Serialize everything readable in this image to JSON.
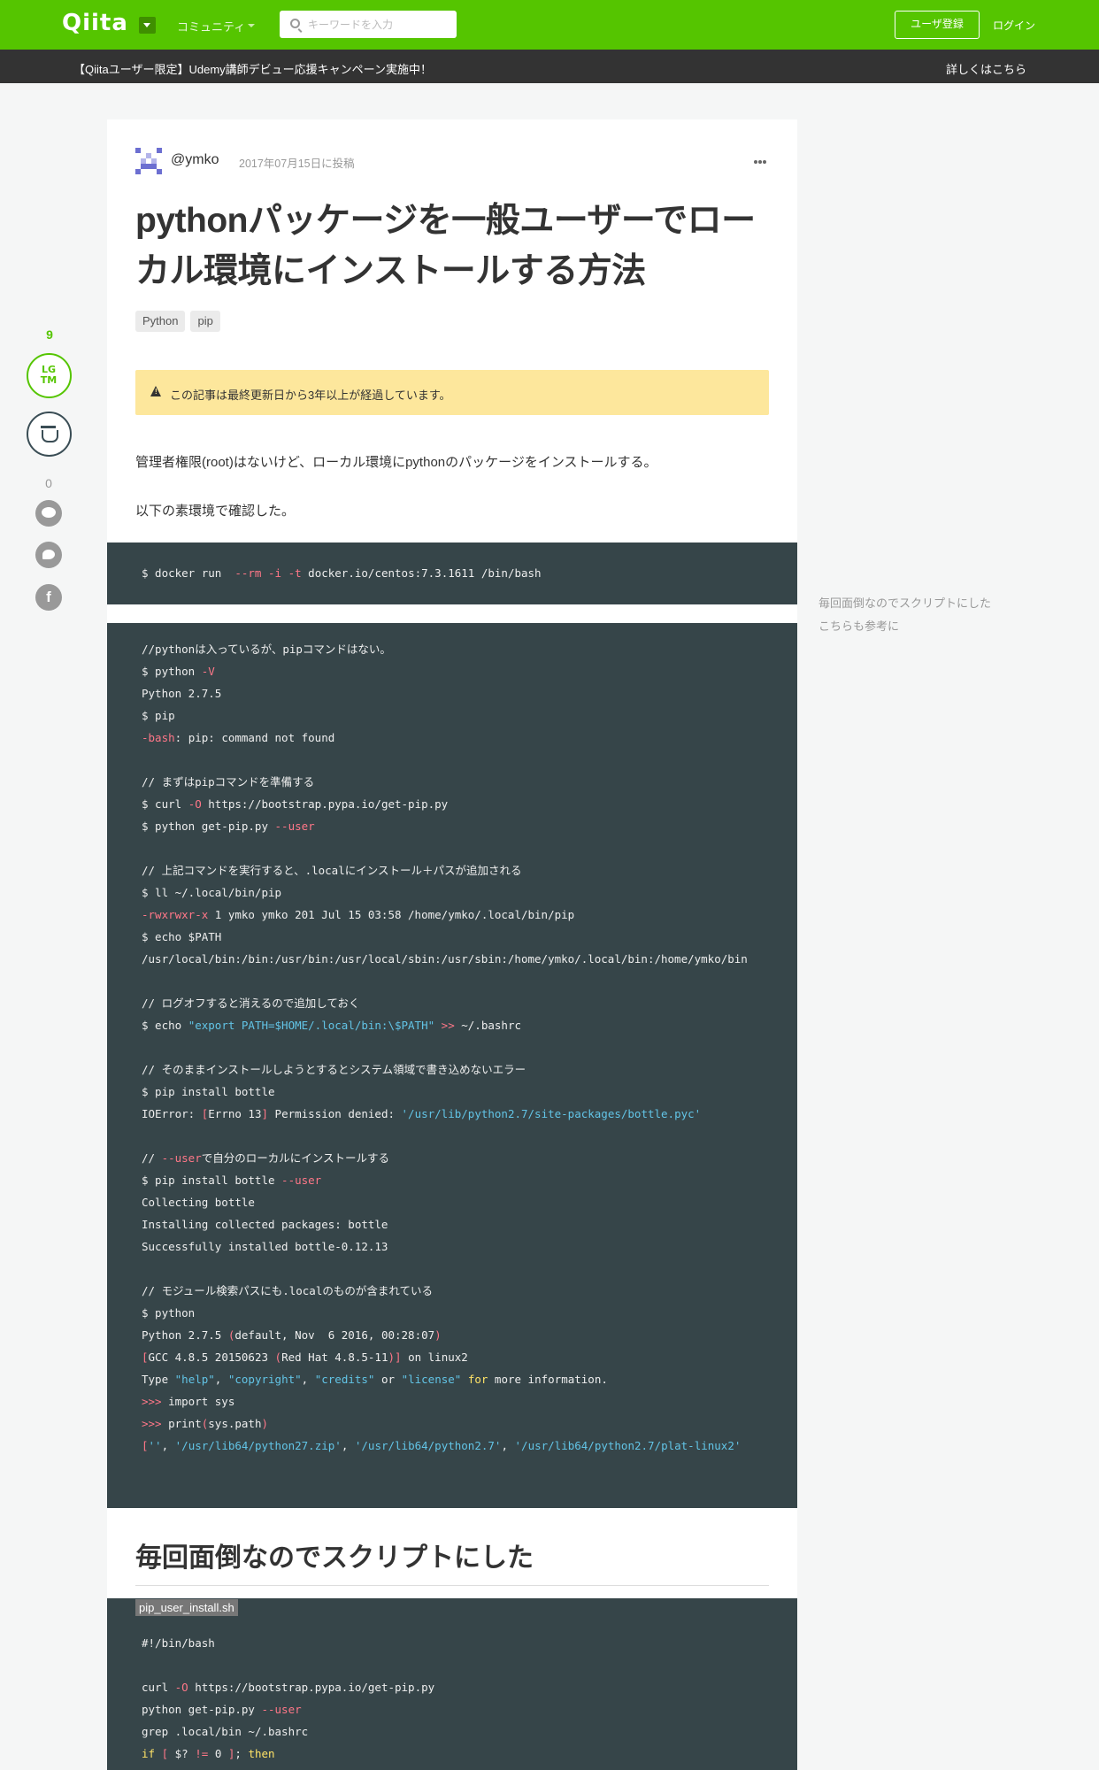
{
  "header": {
    "logo": "Qiita",
    "community_label": "コミュニティ",
    "search_placeholder": "キーワードを入力",
    "signup_label": "ユーザ登録",
    "login_label": "ログイン"
  },
  "banner": {
    "text": "【Qiitaユーザー限定】Udemy講師デビュー応援キャンペーン実施中！",
    "link": "詳しくはこちら"
  },
  "sidebar": {
    "lgtm_count": "9",
    "lgtm_label_top": "LG",
    "lgtm_label_bottom": "TM",
    "comment_count": "0",
    "facebook_glyph": "f"
  },
  "article": {
    "author": "@ymko",
    "posted": "2017年07月15日に投稿",
    "title": "pythonパッケージを一般ユーザーでローカル環境にインストールする方法",
    "tags": [
      "Python",
      "pip"
    ],
    "notice": "この記事は最終更新日から3年以上が経過しています。",
    "para1": "管理者権限(root)はないけど、ローカル環境にpythonのパッケージをインストールする。",
    "para2": "以下の素環境で確認した。",
    "code1": "$ docker run  --rm -i -t docker.io/centos:7.3.1611 /bin/bash",
    "code2": [
      "//pythonは入っているが、pipコマンドはない。",
      "$ python -V",
      "Python 2.7.5",
      "$ pip",
      "-bash: pip: command not found",
      "",
      "// まずはpipコマンドを準備する",
      "$ curl -O https://bootstrap.pypa.io/get-pip.py",
      "$ python get-pip.py --user",
      "",
      "// 上記コマンドを実行すると、.localにインストール＋パスが追加される",
      "$ ll ~/.local/bin/pip",
      "-rwxrwxr-x 1 ymko ymko 201 Jul 15 03:58 /home/ymko/.local/bin/pip",
      "$ echo $PATH",
      "/usr/local/bin:/bin:/usr/bin:/usr/local/sbin:/usr/sbin:/home/ymko/.local/bin:/home/ymko/bin",
      "",
      "// ログオフすると消えるので追加しておく",
      "$ echo \"export PATH=$HOME/.local/bin:\\$PATH\" >> ~/.bashrc",
      "",
      "// そのままインストールしようとするとシステム領域で書き込めないエラー",
      "$ pip install bottle",
      "IOError: [Errno 13] Permission denied: '/usr/lib/python2.7/site-packages/bottle.pyc'",
      "",
      "// --userで自分のローカルにインストールする",
      "$ pip install bottle --user",
      "Collecting bottle",
      "Installing collected packages: bottle",
      "Successfully installed bottle-0.12.13",
      "",
      "// モジュール検索パスにも.localのものが含まれている",
      "$ python",
      "Python 2.7.5 (default, Nov  6 2016, 00:28:07)",
      "[GCC 4.8.5 20150623 (Red Hat 4.8.5-11)] on linux2",
      "Type \"help\", \"copyright\", \"credits\" or \"license\" for more information.",
      ">>> import sys",
      ">>> print(sys.path)",
      "['', '/usr/lib64/python27.zip', '/usr/lib64/python2.7', '/usr/lib64/python2.7/plat-linux2'"
    ],
    "h2": "毎回面倒なのでスクリプトにした",
    "filename": "pip_user_install.sh",
    "code3": [
      "#!/bin/bash",
      "",
      "curl -O https://bootstrap.pypa.io/get-pip.py",
      "python get-pip.py --user",
      "grep .local/bin ~/.bashrc",
      "if [ $? != 0 ]; then"
    ]
  },
  "toc": {
    "items": [
      "毎回面倒なのでスクリプトにした",
      "こちらも参考に"
    ]
  }
}
